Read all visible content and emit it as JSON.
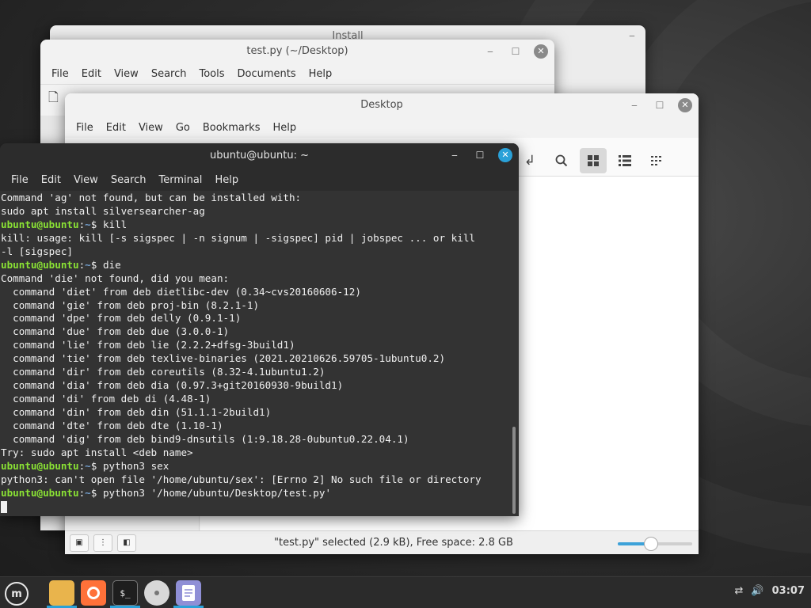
{
  "windows": {
    "install": {
      "title": "Install"
    },
    "editor": {
      "title": "test.py (~/Desktop)",
      "menu": [
        "File",
        "Edit",
        "View",
        "Search",
        "Tools",
        "Documents",
        "Help"
      ]
    },
    "files": {
      "title": "Desktop",
      "menu": [
        "File",
        "Edit",
        "View",
        "Go",
        "Bookmarks",
        "Help"
      ],
      "status": "\"test.py\" selected (2.9 kB), Free space: 2.8 GB",
      "zoom_level": 0.45
    },
    "terminal": {
      "title": "ubuntu@ubuntu: ~",
      "menu": [
        "File",
        "Edit",
        "View",
        "Search",
        "Terminal",
        "Help"
      ],
      "prompt_user": "ubuntu@ubuntu",
      "prompt_path": "~",
      "prompt_suffix": "$ ",
      "lines": [
        {
          "t": "out",
          "text": "Command 'ag' not found, but can be installed with:"
        },
        {
          "t": "out",
          "text": "sudo apt install silversearcher-ag"
        },
        {
          "t": "cmd",
          "text": "kill"
        },
        {
          "t": "out",
          "text": "kill: usage: kill [-s sigspec | -n signum | -sigspec] pid | jobspec ... or kill"
        },
        {
          "t": "out",
          "text": "-l [sigspec]"
        },
        {
          "t": "cmd",
          "text": "die"
        },
        {
          "t": "out",
          "text": "Command 'die' not found, did you mean:"
        },
        {
          "t": "out",
          "text": "  command 'diet' from deb dietlibc-dev (0.34~cvs20160606-12)"
        },
        {
          "t": "out",
          "text": "  command 'gie' from deb proj-bin (8.2.1-1)"
        },
        {
          "t": "out",
          "text": "  command 'dpe' from deb delly (0.9.1-1)"
        },
        {
          "t": "out",
          "text": "  command 'due' from deb due (3.0.0-1)"
        },
        {
          "t": "out",
          "text": "  command 'lie' from deb lie (2.2.2+dfsg-3build1)"
        },
        {
          "t": "out",
          "text": "  command 'tie' from deb texlive-binaries (2021.20210626.59705-1ubuntu0.2)"
        },
        {
          "t": "out",
          "text": "  command 'dir' from deb coreutils (8.32-4.1ubuntu1.2)"
        },
        {
          "t": "out",
          "text": "  command 'dia' from deb dia (0.97.3+git20160930-9build1)"
        },
        {
          "t": "out",
          "text": "  command 'di' from deb di (4.48-1)"
        },
        {
          "t": "out",
          "text": "  command 'din' from deb din (51.1.1-2build1)"
        },
        {
          "t": "out",
          "text": "  command 'dte' from deb dte (1.10-1)"
        },
        {
          "t": "out",
          "text": "  command 'dig' from deb bind9-dnsutils (1:9.18.28-0ubuntu0.22.04.1)"
        },
        {
          "t": "out",
          "text": "Try: sudo apt install <deb name>"
        },
        {
          "t": "cmd",
          "text": "python3 sex"
        },
        {
          "t": "out",
          "text": "python3: can't open file '/home/ubuntu/sex': [Errno 2] No such file or directory"
        },
        {
          "t": "cmd",
          "text": "python3 '/home/ubuntu/Desktop/test.py'"
        },
        {
          "t": "cursor",
          "text": ""
        }
      ]
    }
  },
  "taskbar": {
    "apps": [
      {
        "name": "files-icon",
        "color": "#e9b44c",
        "active": true
      },
      {
        "name": "firefox-icon",
        "color": "#ff7139",
        "active": false
      },
      {
        "name": "terminal-icon",
        "color": "#1e1e1e",
        "active": true
      },
      {
        "name": "disc-icon",
        "color": "#d8d8d8",
        "active": false
      },
      {
        "name": "text-editor-icon",
        "color": "#8f8fd6",
        "active": true
      }
    ],
    "clock": "03:07"
  }
}
